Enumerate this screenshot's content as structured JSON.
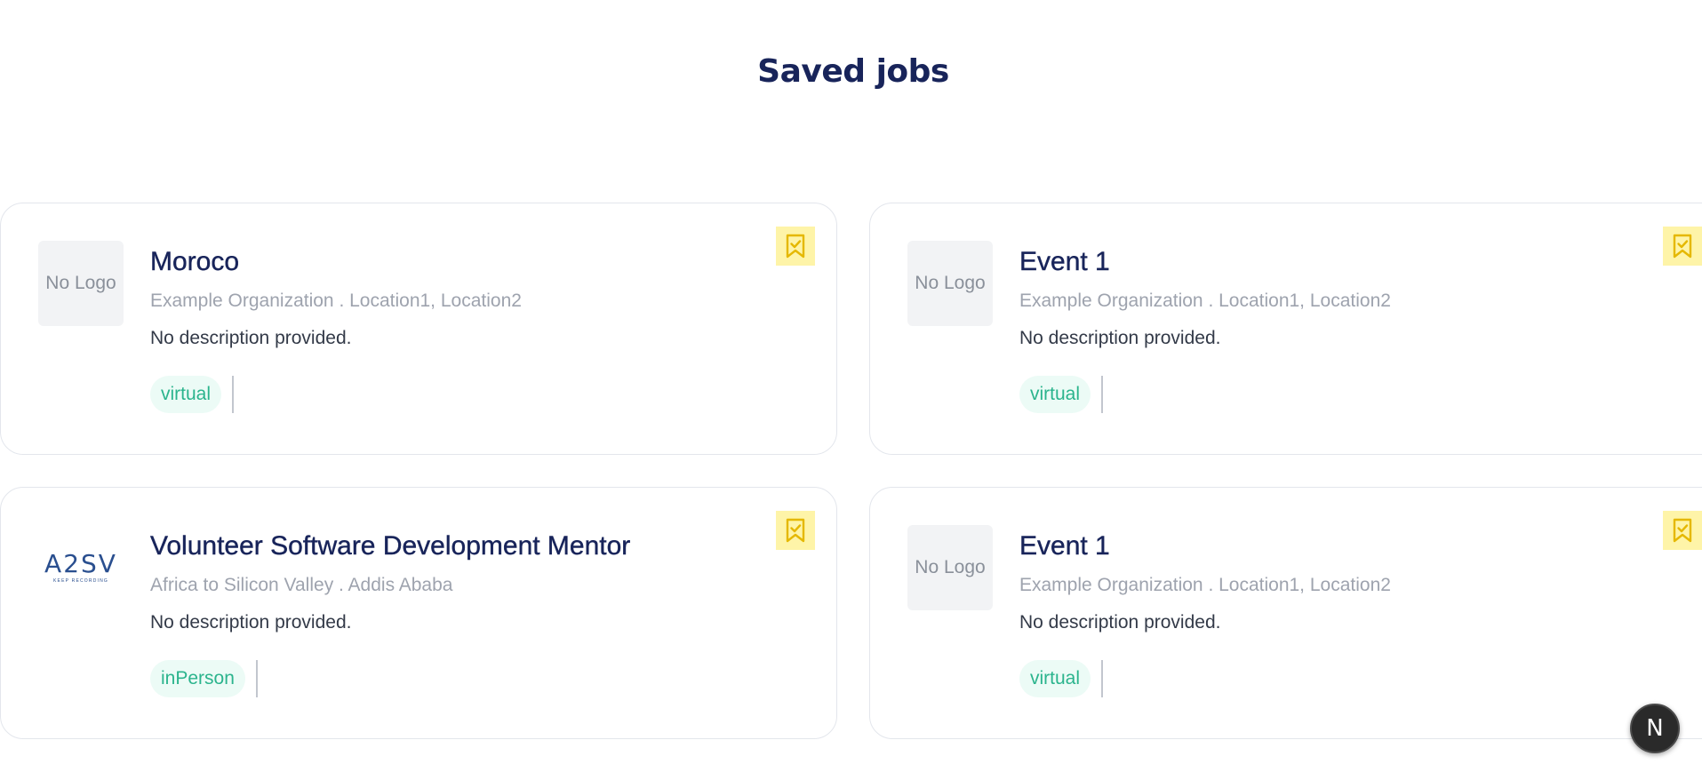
{
  "page": {
    "title": "Saved jobs"
  },
  "colors": {
    "title": "#18245a",
    "tag_text": "#2bb48d",
    "tag_bg": "#ecfbf6",
    "bookmark_bg": "#fef4a8",
    "bookmark_icon": "#e5b800"
  },
  "jobs": [
    {
      "title": "Moroco",
      "logo_text": "No Logo",
      "meta": "Example Organization . Location1, Location2",
      "description": "No description provided.",
      "tag": "virtual",
      "bookmark_icon": "bookmark-check-icon"
    },
    {
      "title": "Event 1",
      "logo_text": "No Logo",
      "meta": "Example Organization . Location1, Location2",
      "description": "No description provided.",
      "tag": "virtual",
      "bookmark_icon": "bookmark-check-icon"
    },
    {
      "title": "Volunteer Software Development Mentor",
      "logo_text": "A2SV",
      "logo_subtext": "KEEP RECORDING",
      "meta": "Africa to Silicon Valley . Addis Ababa",
      "description": "No description provided.",
      "tag": "inPerson",
      "bookmark_icon": "bookmark-check-icon"
    },
    {
      "title": "Event 1",
      "logo_text": "No Logo",
      "meta": "Example Organization . Location1, Location2",
      "description": "No description provided.",
      "tag": "virtual",
      "bookmark_icon": "bookmark-check-icon"
    }
  ],
  "dev_badge": {
    "label": "N",
    "icon": "nextjs-logo-icon"
  }
}
